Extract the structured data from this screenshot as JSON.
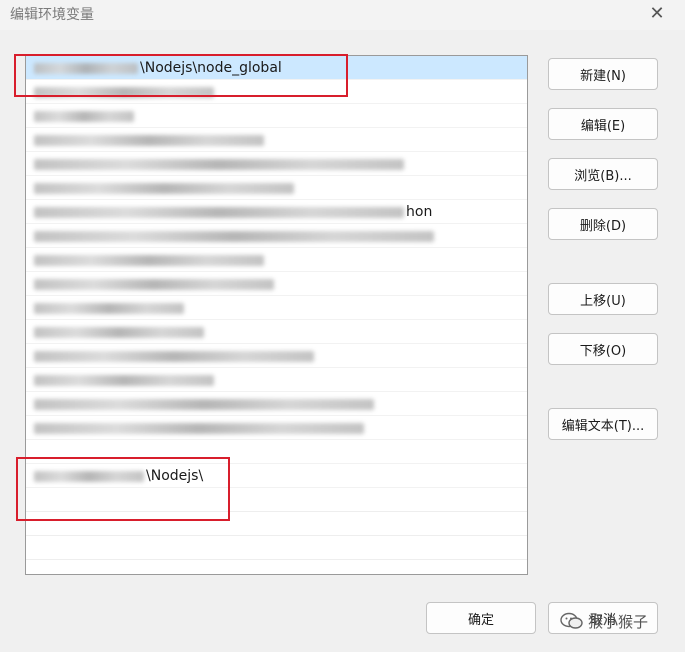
{
  "window": {
    "title": "编辑环境变量"
  },
  "list": {
    "rows": [
      {
        "blurred_width": 104,
        "suffix": "\\Nodejs\\node_global",
        "selected": true
      },
      {
        "blurred_width": 180,
        "suffix": ""
      },
      {
        "blurred_width": 100,
        "suffix": ""
      },
      {
        "blurred_width": 230,
        "suffix": ""
      },
      {
        "blurred_width": 370,
        "suffix": ""
      },
      {
        "blurred_width": 260,
        "suffix": ""
      },
      {
        "blurred_width": 370,
        "suffix": "hon"
      },
      {
        "blurred_width": 400,
        "suffix": ""
      },
      {
        "blurred_width": 230,
        "suffix": ""
      },
      {
        "blurred_width": 240,
        "suffix": ""
      },
      {
        "blurred_width": 150,
        "suffix": ""
      },
      {
        "blurred_width": 170,
        "suffix": ""
      },
      {
        "blurred_width": 280,
        "suffix": ""
      },
      {
        "blurred_width": 180,
        "suffix": ""
      },
      {
        "blurred_width": 340,
        "suffix": ""
      },
      {
        "blurred_width": 330,
        "suffix": ""
      },
      {
        "blurred_width": 0,
        "suffix": ""
      },
      {
        "blurred_width": 110,
        "suffix": "\\Nodejs\\"
      }
    ]
  },
  "buttons": {
    "new": "新建(N)",
    "edit": "编辑(E)",
    "browse": "浏览(B)...",
    "delete": "删除(D)",
    "move_up": "上移(U)",
    "move_down": "下移(O)",
    "edit_text": "编辑文本(T)...",
    "ok": "确定",
    "cancel": "取消"
  },
  "watermark": {
    "text": "猴小猴子"
  },
  "colors": {
    "highlight": "#d81e2c",
    "selected_row": "#cce8ff"
  }
}
